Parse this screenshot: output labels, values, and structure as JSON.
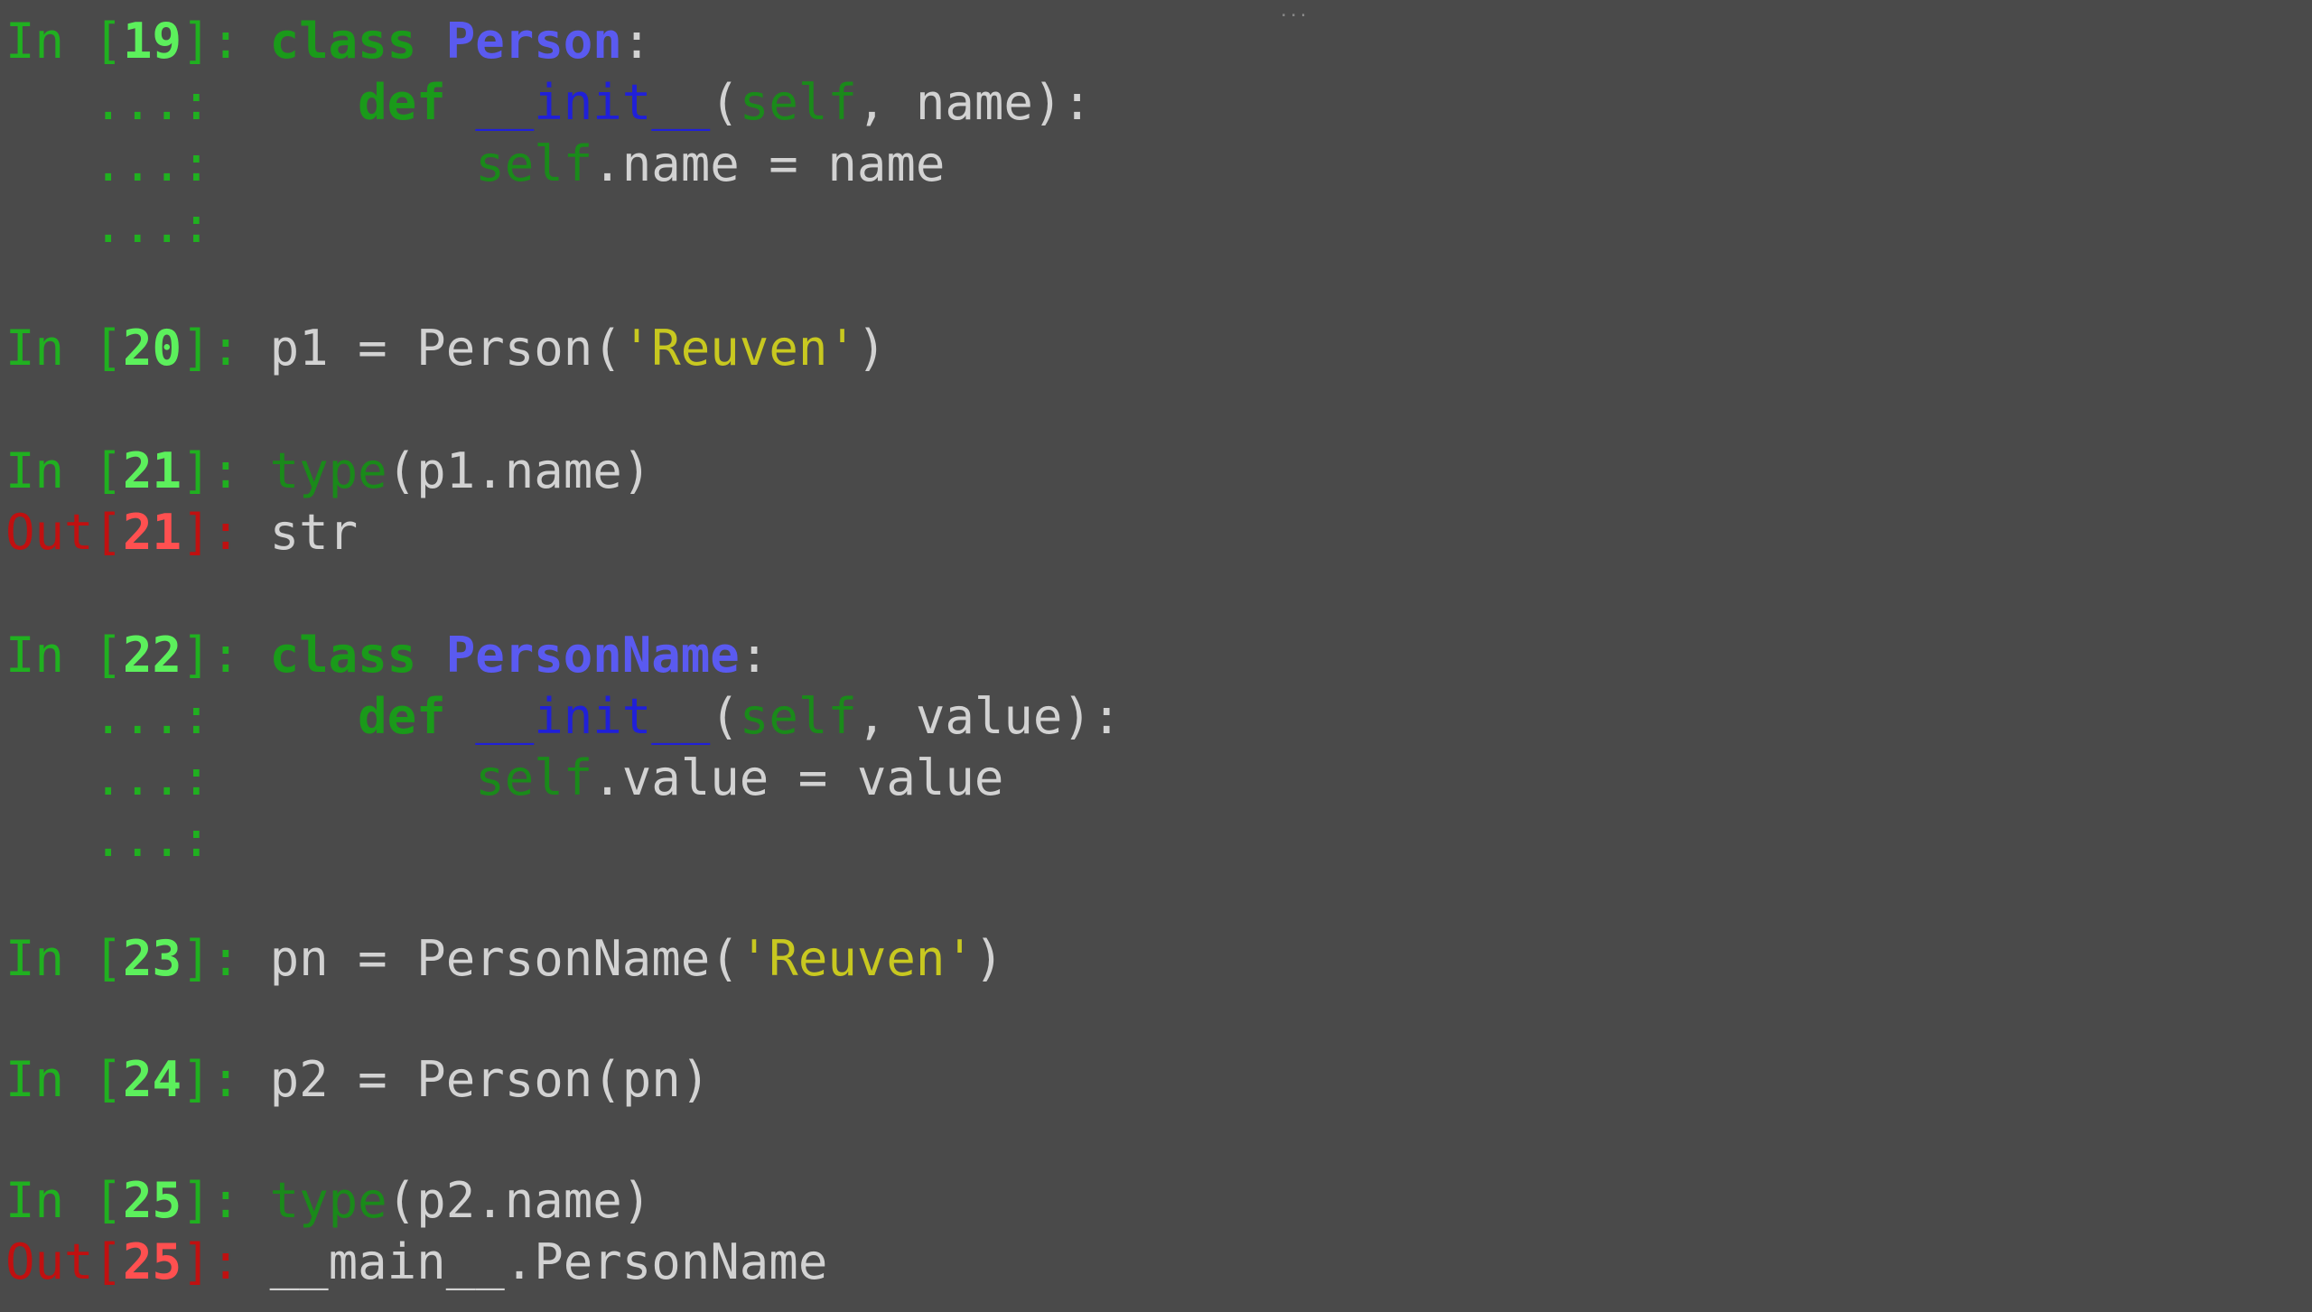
{
  "top_mark": "...",
  "cells": {
    "c19": {
      "in_label": "In [",
      "num": "19",
      "in_close": "]: ",
      "l1_kw": "class",
      "l1_name": "Person",
      "l1_colon": ":",
      "cont": "   ...: ",
      "l2_indent": "    ",
      "l2_def": "def",
      "l2_init": "__init__",
      "l2_open": "(",
      "l2_self": "self",
      "l2_rest": ", name):",
      "l3_indent": "        ",
      "l3_self": "self",
      "l3_rest": ".name = name"
    },
    "c20": {
      "in_label": "In [",
      "num": "20",
      "in_close": "]: ",
      "code_a": "p1 = Person(",
      "code_str": "'Reuven'",
      "code_b": ")"
    },
    "c21": {
      "in_label": "In [",
      "num": "21",
      "in_close": "]: ",
      "code_type": "type",
      "code_rest": "(p1.name)",
      "out_label": "Out[",
      "out_num": "21",
      "out_close": "]: ",
      "out_value": "str"
    },
    "c22": {
      "in_label": "In [",
      "num": "22",
      "in_close": "]: ",
      "l1_kw": "class",
      "l1_name": "PersonName",
      "l1_colon": ":",
      "cont": "   ...: ",
      "l2_indent": "    ",
      "l2_def": "def",
      "l2_init": "__init__",
      "l2_open": "(",
      "l2_self": "self",
      "l2_rest": ", value):",
      "l3_indent": "        ",
      "l3_self": "self",
      "l3_rest": ".value = value"
    },
    "c23": {
      "in_label": "In [",
      "num": "23",
      "in_close": "]: ",
      "code_a": "pn = PersonName(",
      "code_str": "'Reuven'",
      "code_b": ")"
    },
    "c24": {
      "in_label": "In [",
      "num": "24",
      "in_close": "]: ",
      "code": "p2 = Person(pn)"
    },
    "c25": {
      "in_label": "In [",
      "num": "25",
      "in_close": "]: ",
      "code_type": "type",
      "code_rest": "(p2.name)",
      "out_label": "Out[",
      "out_num": "25",
      "out_close": "]: ",
      "out_value": "__main__.PersonName"
    }
  },
  "colors": {
    "background": "#4a4a4a",
    "prompt_in": "#20b020",
    "prompt_out": "#c01010",
    "keyword": "#1a9a1a",
    "class_name": "#5a5af0",
    "function_name": "#2020d8",
    "string": "#c8c820",
    "text": "#d2d2d2"
  }
}
